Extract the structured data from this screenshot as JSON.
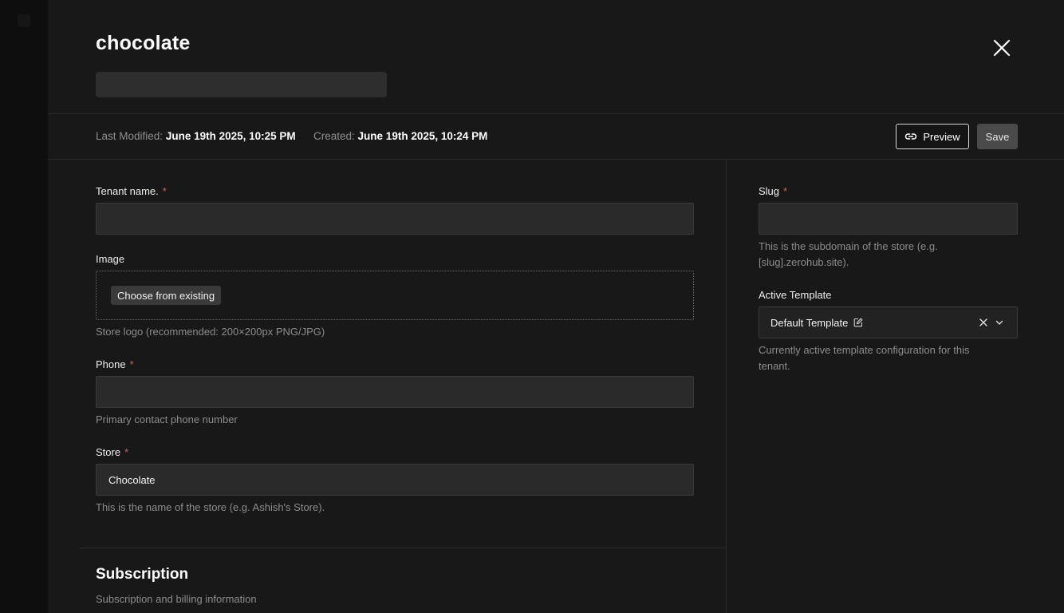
{
  "header": {
    "title": "chocolate"
  },
  "meta": {
    "last_modified_label": "Last Modified:",
    "last_modified_value": "June 19th 2025, 10:25 PM",
    "created_label": "Created:",
    "created_value": "June 19th 2025, 10:24 PM"
  },
  "actions": {
    "preview_label": "Preview",
    "save_label": "Save"
  },
  "form": {
    "tenant_name": {
      "label": "Tenant name.",
      "required_mark": "*",
      "value": ""
    },
    "image": {
      "label": "Image",
      "choose_label": "Choose from existing",
      "help": "Store logo (recommended: 200×200px PNG/JPG)"
    },
    "phone": {
      "label": "Phone",
      "required_mark": "*",
      "value": "",
      "help": "Primary contact phone number"
    },
    "store": {
      "label": "Store",
      "required_mark": "*",
      "value": "Chocolate",
      "help": "This is the name of the store (e.g. Ashish's Store)."
    },
    "slug": {
      "label": "Slug",
      "required_mark": "*",
      "value": "",
      "help_line1": "This is the subdomain of the store (e.g.",
      "help_line2": "[slug].zerohub.site)."
    },
    "active_template": {
      "label": "Active Template",
      "value": "Default Template",
      "help_line1": "Currently active template configuration for this",
      "help_line2": "tenant."
    }
  },
  "subscription": {
    "title": "Subscription",
    "description": "Subscription and billing information"
  },
  "colors": {
    "background": "#181818",
    "input_background": "#2a2a2a",
    "required": "#d9624d",
    "tab_accent": "#3b82f6"
  },
  "icons": {
    "close": "close-icon",
    "preview": "link-icon",
    "edit": "edit-icon",
    "clear": "clear-icon",
    "dropdown": "chevron-down-icon"
  }
}
